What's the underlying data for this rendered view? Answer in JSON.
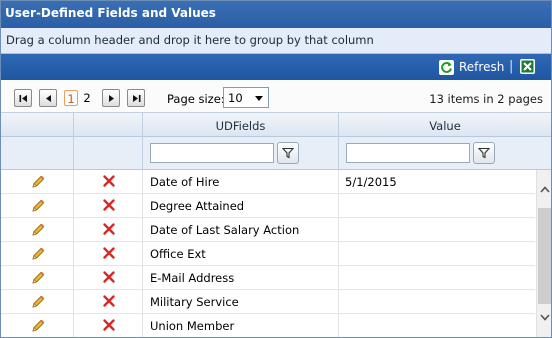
{
  "title": "User-Defined Fields and Values",
  "group_hint": "Drag a column header and drop it here to group by that column",
  "toolbar": {
    "refresh_label": "Refresh",
    "separator": "|",
    "export_icon": "excel-icon"
  },
  "pager": {
    "pages": [
      "1",
      "2"
    ],
    "current_page": "1",
    "page_size_label": "Page size:",
    "page_size": "10",
    "items_info": "13 items in 2 pages"
  },
  "columns": {
    "udfields": "UDFields",
    "value": "Value"
  },
  "filters": {
    "udfields_value": "",
    "value_value": ""
  },
  "rows": [
    {
      "field": "Date of Hire",
      "value": "5/1/2015"
    },
    {
      "field": "Degree Attained",
      "value": ""
    },
    {
      "field": "Date of Last Salary Action",
      "value": ""
    },
    {
      "field": "Office Ext",
      "value": ""
    },
    {
      "field": "E-Mail Address",
      "value": ""
    },
    {
      "field": "Military Service",
      "value": ""
    },
    {
      "field": "Union Member",
      "value": ""
    }
  ],
  "icons": {
    "edit": "pencil-icon",
    "delete": "red-x-icon"
  },
  "colors": {
    "title_bar": "#2a5ea6",
    "group_bar": "#e3ecf8",
    "toolbar": "#1f56a1",
    "current_page": "#c2631a",
    "delete": "#d42a2a",
    "edit": "#e0a020"
  }
}
